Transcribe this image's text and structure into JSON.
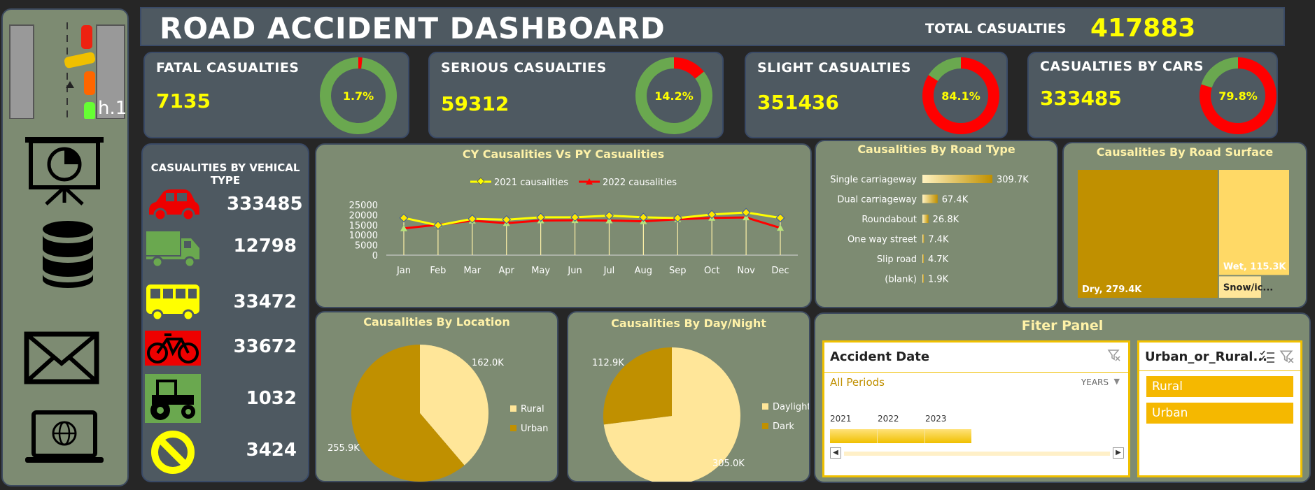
{
  "header": {
    "title": "ROAD ACCIDENT DASHBOARD",
    "total_label": "TOTAL CASUALTIES",
    "total_value": "417883"
  },
  "sidebar": {
    "logo_text": "h.1",
    "icons": [
      "presentation-chart-icon",
      "database-icon",
      "mail-icon",
      "laptop-globe-icon"
    ]
  },
  "kpis": [
    {
      "label": "FATAL CASUALTIES",
      "value": "7135",
      "pct_label": "1.7%",
      "pct": 1.7
    },
    {
      "label": "SERIOUS CASUALTIES",
      "value": "59312",
      "pct_label": "14.2%",
      "pct": 14.2
    },
    {
      "label": "SLIGHT CASUALTIES",
      "value": "351436",
      "pct_label": "84.1%",
      "pct": 84.1
    },
    {
      "label": "CASUALTIES BY CARS",
      "value": "333485",
      "pct_label": "79.8%",
      "pct": 79.8
    }
  ],
  "vehicle": {
    "title": "CASUALITIES BY VEHICAL TYPE",
    "items": [
      {
        "icon": "car-icon",
        "value": "333485"
      },
      {
        "icon": "truck-icon",
        "value": "12798"
      },
      {
        "icon": "bus-icon",
        "value": "33472"
      },
      {
        "icon": "bicycle-icon",
        "value": "33672"
      },
      {
        "icon": "tractor-icon",
        "value": "1032"
      },
      {
        "icon": "no-entry-icon",
        "value": "3424"
      }
    ]
  },
  "colors": {
    "red": "#ff0000",
    "green": "#6aa84f",
    "yellow": "#ffff00",
    "gold": "#c09000",
    "cream": "#ffe699",
    "sage": "#7d8b72",
    "slate": "#4e5961"
  },
  "chart_data": [
    {
      "type": "line",
      "title": "CY Causalities Vs PY Casualities",
      "categories": [
        "Jan",
        "Feb",
        "Mar",
        "Apr",
        "May",
        "Jun",
        "Jul",
        "Aug",
        "Sep",
        "Oct",
        "Nov",
        "Dec"
      ],
      "series": [
        {
          "name": "2021 causalities",
          "color": "#ffff00",
          "values": [
            18500,
            14800,
            18000,
            17600,
            18800,
            18800,
            19600,
            18800,
            18400,
            20200,
            21200,
            18500
          ]
        },
        {
          "name": "2022 causalities",
          "color": "#ff0000",
          "values": [
            13300,
            15100,
            17100,
            15900,
            17200,
            17300,
            17200,
            16800,
            17800,
            18500,
            18700,
            13500
          ]
        }
      ],
      "yticks": [
        "25000",
        "20000",
        "15000",
        "10000",
        "5000",
        "0"
      ],
      "ylim": [
        0,
        25000
      ]
    },
    {
      "type": "bar",
      "title": "Causalities By Road Type",
      "categories": [
        "Single carriageway",
        "Dual carriageway",
        "Roundabout",
        "One way street",
        "Slip road",
        "(blank)"
      ],
      "values": [
        309.7,
        67.4,
        26.8,
        7.4,
        4.7,
        1.9
      ],
      "labels": [
        "309.7K",
        "67.4K",
        "26.8K",
        "7.4K",
        "4.7K",
        "1.9K"
      ]
    },
    {
      "type": "treemap",
      "title": "Causalities  By Road Surface",
      "categories": [
        "Dry",
        "Wet",
        "Snow/ic..."
      ],
      "values": [
        279.4,
        115.3,
        23.2
      ],
      "labels": [
        "Dry, 279.4K",
        "Wet, 115.3K",
        "Snow/ic..."
      ]
    },
    {
      "type": "pie",
      "title": "Causalities By Location",
      "categories": [
        "Rural",
        "Urban"
      ],
      "values": [
        162.0,
        255.9
      ],
      "labels": [
        "162.0K",
        "255.9K"
      ],
      "colors": [
        "#ffe699",
        "#c09000"
      ]
    },
    {
      "type": "pie",
      "title": "Causalities By Day/Night",
      "categories": [
        "Daylight",
        "Dark"
      ],
      "values": [
        305.0,
        112.9
      ],
      "labels": [
        "305.0K",
        "112.9K"
      ],
      "colors": [
        "#ffe699",
        "#c09000"
      ]
    }
  ],
  "filter": {
    "title": "Fiter Panel",
    "date": {
      "title": "Accident Date",
      "periods": "All Periods",
      "level": "YEARS",
      "years": [
        "2021",
        "2022",
        "2023"
      ]
    },
    "urban": {
      "title": "Urban_or_Rural...",
      "options": [
        "Rural",
        "Urban"
      ]
    }
  }
}
